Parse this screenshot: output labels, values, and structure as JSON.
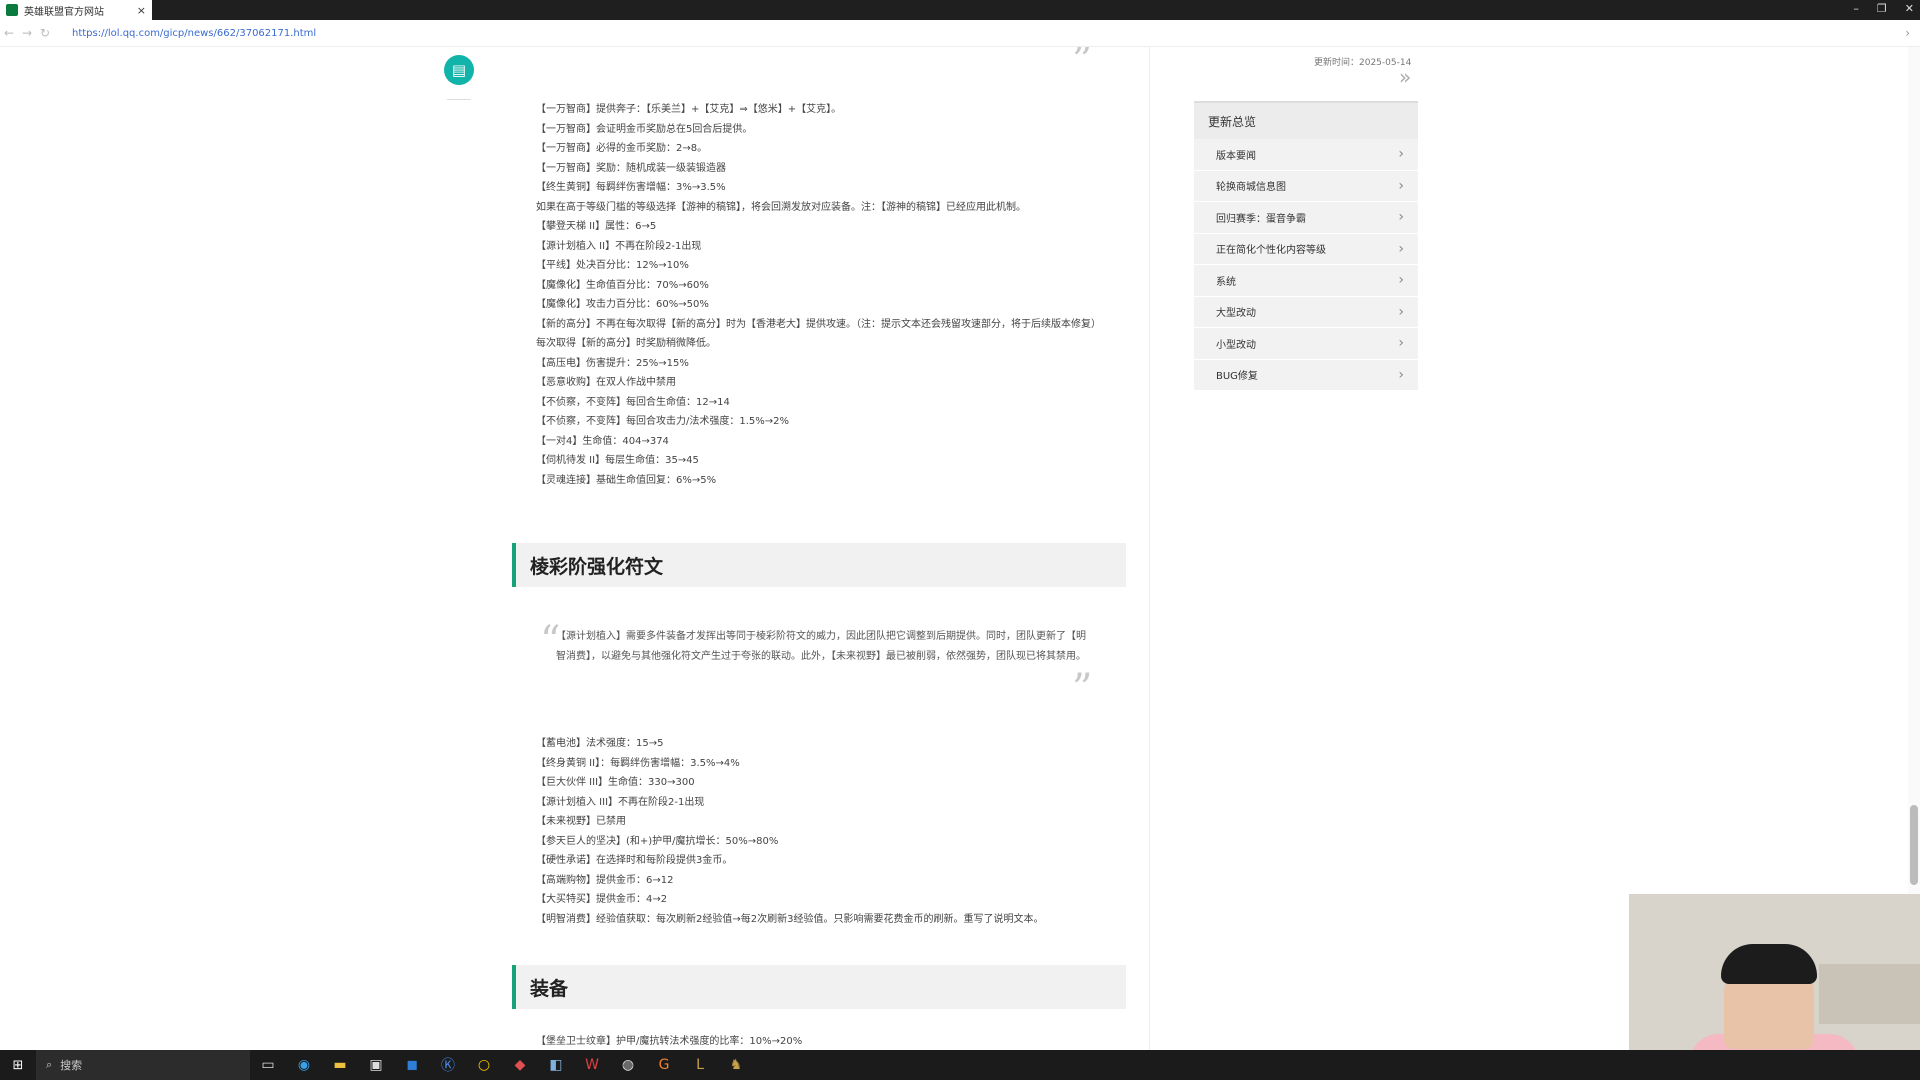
{
  "browser": {
    "tab_title": "英雄联盟官方网站",
    "tab_close": "×",
    "url": "https://lol.qq.com/gicp/news/662/37062171.html",
    "window_controls": [
      "–",
      "❐",
      "✕"
    ]
  },
  "article": {
    "block1": [
      "【一万智商】提供奔子：【乐美兰】+【艾克】⇒【悠米】+【艾克】。",
      "【一万智商】会证明金币奖励总在5回合后提供。",
      "【一万智商】必得的金币奖励：2→8。",
      "【一万智商】奖励：随机成装一级装锻造器",
      "【终生黄铜】每羁绊伤害增幅：3%→3.5%",
      "如果在高于等级门槛的等级选择【游神的稿锦】，将会回溯发放对应装备。注：【游神的稿锦】已经应用此机制。",
      "【攀登天梯 II】属性：6→5",
      "【源计划植入 II】不再在阶段2-1出现",
      "【平线】处决百分比：12%→10%",
      "【魔像化】生命值百分比：70%→60%",
      "【魔像化】攻击力百分比：60%→50%"
    ],
    "block1_wrap": "【新的高分】不再在每次取得【新的高分】时为【香港老大】提供攻速。（注：提示文本还会残留攻速部分，将于后续版本修复）",
    "block1b": [
      "每次取得【新的高分】时奖励稍微降低。",
      "【高压电】伤害提升：25%→15%",
      "【恶意收购】在双人作战中禁用",
      "【不侦察，不变阵】每回合生命值：12→14",
      "【不侦察，不变阵】每回合攻击力/法术强度：1.5%→2%",
      "【一对4】生命值：404→374",
      "【伺机待发 II】每层生命值：35→45",
      "【灵魂连接】基础生命值回复：6%→5%"
    ],
    "section1_title": "棱彩阶强化符文",
    "quote_text": "【源计划植入】需要多件装备才发挥出等同于棱彩阶符文的威力，因此团队把它调整到后期提供。同时，团队更新了【明智消费】，以避免与其他强化符文产生过于夸张的联动。此外，【未来视野】最已被削弱，依然强势，团队现已将其禁用。",
    "block2": [
      "【蓄电池】法术强度：15→5",
      "【终身黄铜 II】：每羁绊伤害增幅：3.5%→4%",
      "【巨大伙伴 III】生命值：330→300",
      "【源计划植入 III】不再在阶段2-1出现",
      "【未来视野】已禁用",
      "【参天巨人的坚决】(和+)护甲/魔抗增长：50%→80%",
      "【硬性承诺】在选择时和每阶段提供3金币。",
      "【高端购物】提供金币：6→12",
      "【大买特买】提供金币：4→2",
      "【明智消费】经验值获取：每次刷新2经验值→每2次刷新3经验值。只影响需要花费金币的刷新。重写了说明文本。"
    ],
    "section2_title": "装备",
    "block3": [
      "【堡垒卫士纹章】护甲/魔抗转法术强度的比率：10%→20%"
    ],
    "quote_close_glyph": "”",
    "quote_open_glyph": "“"
  },
  "float_button": {
    "icon": "comment-icon"
  },
  "sidebar": {
    "updated": "更新时间：2025-05-14",
    "expand_glyph": "»",
    "panel_title": "更新总览",
    "items": [
      "版本要闻",
      "轮换商城信息图",
      "回归赛季：蛋音争霸",
      "正在简化个性化内容等级",
      "系统",
      "大型改动",
      "小型改动",
      "BUG修复"
    ],
    "chevron": "›"
  },
  "taskbar": {
    "start_glyph": "⊞",
    "search_placeholder": "搜索",
    "search_icon": "search-icon"
  },
  "colors": {
    "accent": "#17a27a",
    "float_button": "#12b3a8"
  }
}
